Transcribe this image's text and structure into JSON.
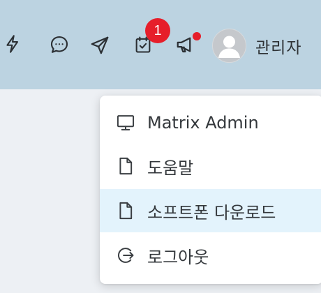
{
  "header": {
    "icons": [
      {
        "name": "lightning-icon"
      },
      {
        "name": "chat-icon"
      },
      {
        "name": "send-icon"
      },
      {
        "name": "calendar-check-icon"
      },
      {
        "name": "megaphone-icon"
      }
    ],
    "notification_count": "1",
    "user_name": "관리자"
  },
  "menu": {
    "items": [
      {
        "label": "Matrix Admin",
        "icon": "monitor-icon"
      },
      {
        "label": "도움말",
        "icon": "document-icon"
      },
      {
        "label": "소프트폰 다운로드",
        "icon": "document-icon",
        "highlighted": true
      },
      {
        "label": "로그아웃",
        "icon": "logout-icon"
      }
    ]
  },
  "colors": {
    "header_bg": "#bcd3e1",
    "page_bg": "#edf0f4",
    "badge": "#e61e2a",
    "highlight": "#e3f3fc"
  }
}
